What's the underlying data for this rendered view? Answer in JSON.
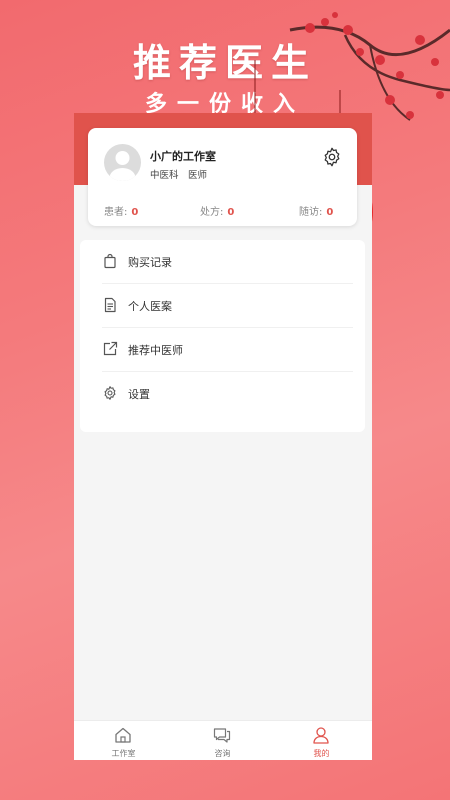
{
  "poster": {
    "headline": "推荐医生",
    "subline": "多一份收入"
  },
  "profile": {
    "studio_name": "小广的工作室",
    "department": "中医科",
    "title": "医师",
    "settings_icon": "gear-icon"
  },
  "stats": [
    {
      "label": "患者:",
      "value": "0"
    },
    {
      "label": "处方:",
      "value": "0"
    },
    {
      "label": "随访:",
      "value": "0"
    }
  ],
  "menu": [
    {
      "label": "购买记录",
      "icon": "shopping-bag-icon"
    },
    {
      "label": "个人医案",
      "icon": "document-icon"
    },
    {
      "label": "推荐中医师",
      "icon": "share-icon"
    },
    {
      "label": "设置",
      "icon": "gear-icon"
    }
  ],
  "tabbar": [
    {
      "label": "工作室",
      "icon": "home-icon",
      "active": false
    },
    {
      "label": "咨询",
      "icon": "chat-icon",
      "active": false
    },
    {
      "label": "我的",
      "icon": "user-icon",
      "active": true
    }
  ],
  "colors": {
    "accent": "#e0534c",
    "background": "#f47a7c"
  }
}
